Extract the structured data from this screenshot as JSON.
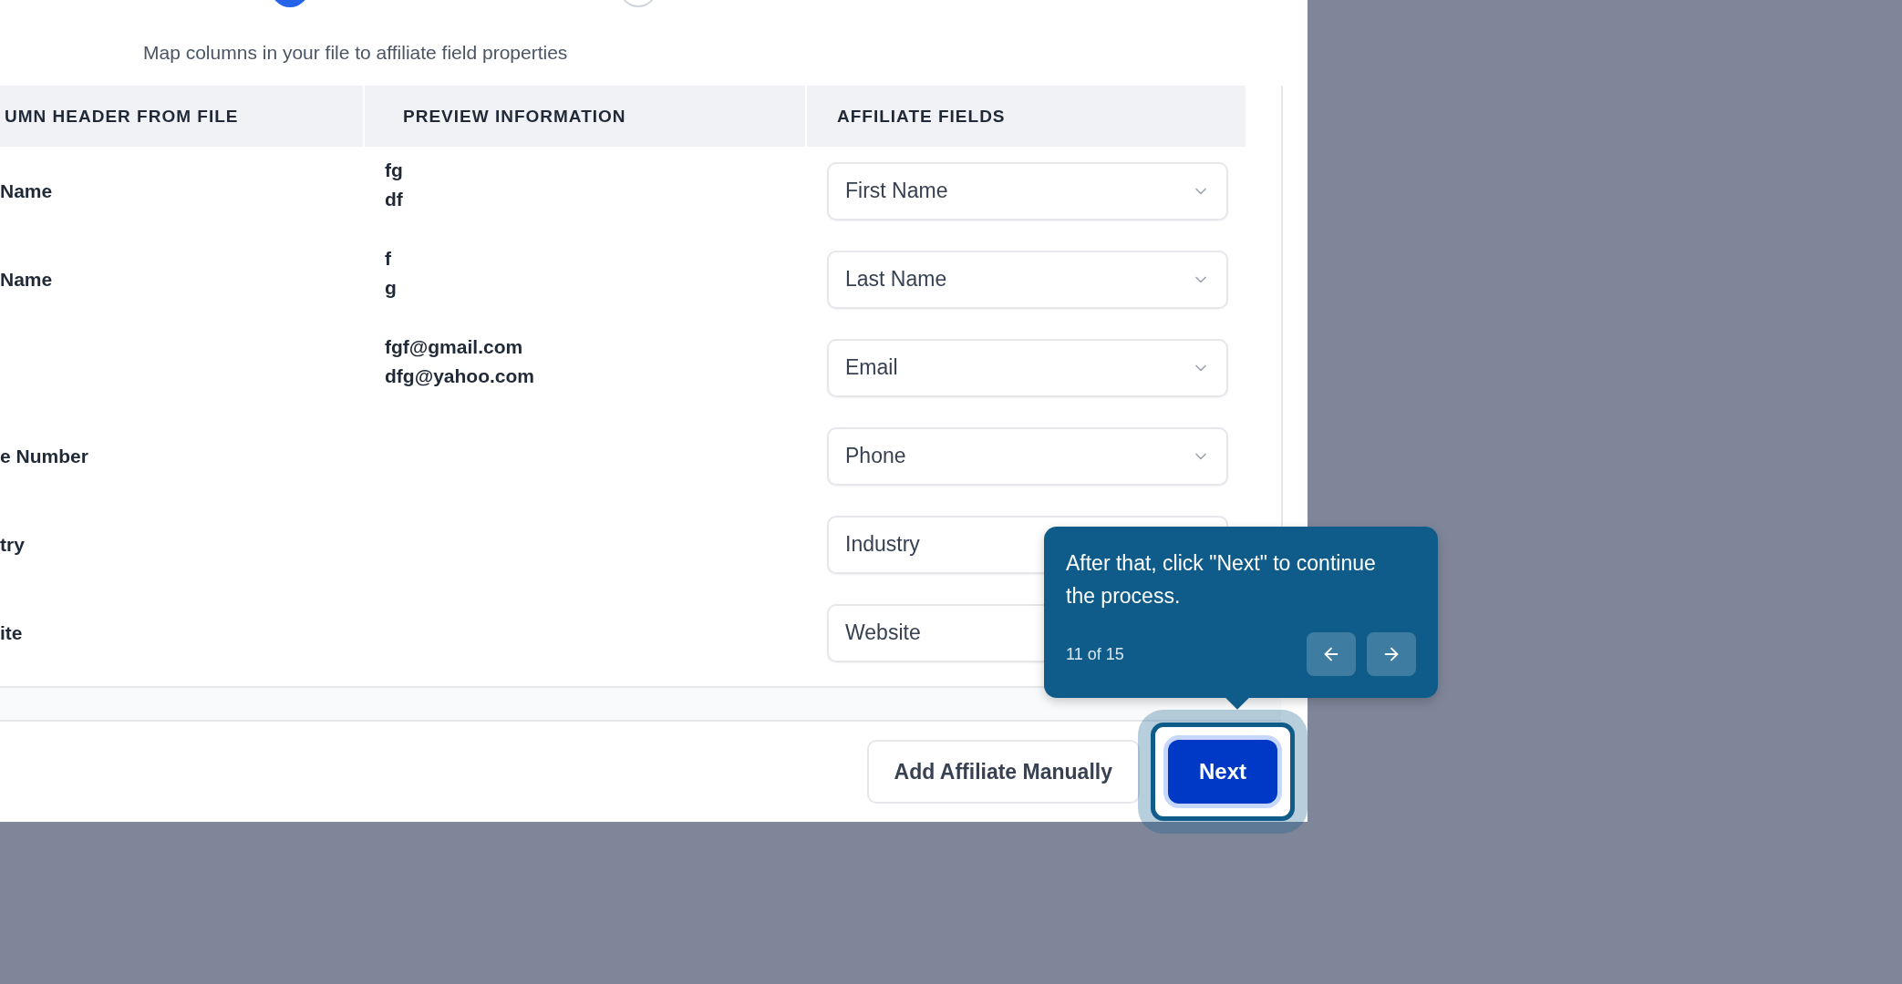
{
  "steps": [
    {
      "selected": true
    },
    {
      "selected": false
    }
  ],
  "subtitle": "Map columns in your file to affiliate field properties",
  "table": {
    "columns": [
      "UMN HEADER FROM FILE",
      "PREVIEW INFORMATION",
      "AFFILIATE FIELDS"
    ],
    "rows": [
      {
        "file_column": "Name",
        "preview": [
          "fg",
          "df"
        ],
        "field": "First Name"
      },
      {
        "file_column": "Name",
        "preview": [
          "f",
          "g"
        ],
        "field": "Last Name"
      },
      {
        "file_column": "",
        "preview": [
          "fgf@gmail.com",
          "dfg@yahoo.com"
        ],
        "field": "Email"
      },
      {
        "file_column": "e Number",
        "preview": [],
        "field": "Phone"
      },
      {
        "file_column": "try",
        "preview": [],
        "field": "Industry"
      },
      {
        "file_column": "ite",
        "preview": [],
        "field": "Website"
      }
    ]
  },
  "footer": {
    "secondary_button": "Add Affiliate Manually",
    "primary_button": "Next"
  },
  "tour": {
    "text": "After that, click \"Next\" to continue the process.",
    "progress": "11 of 15"
  }
}
